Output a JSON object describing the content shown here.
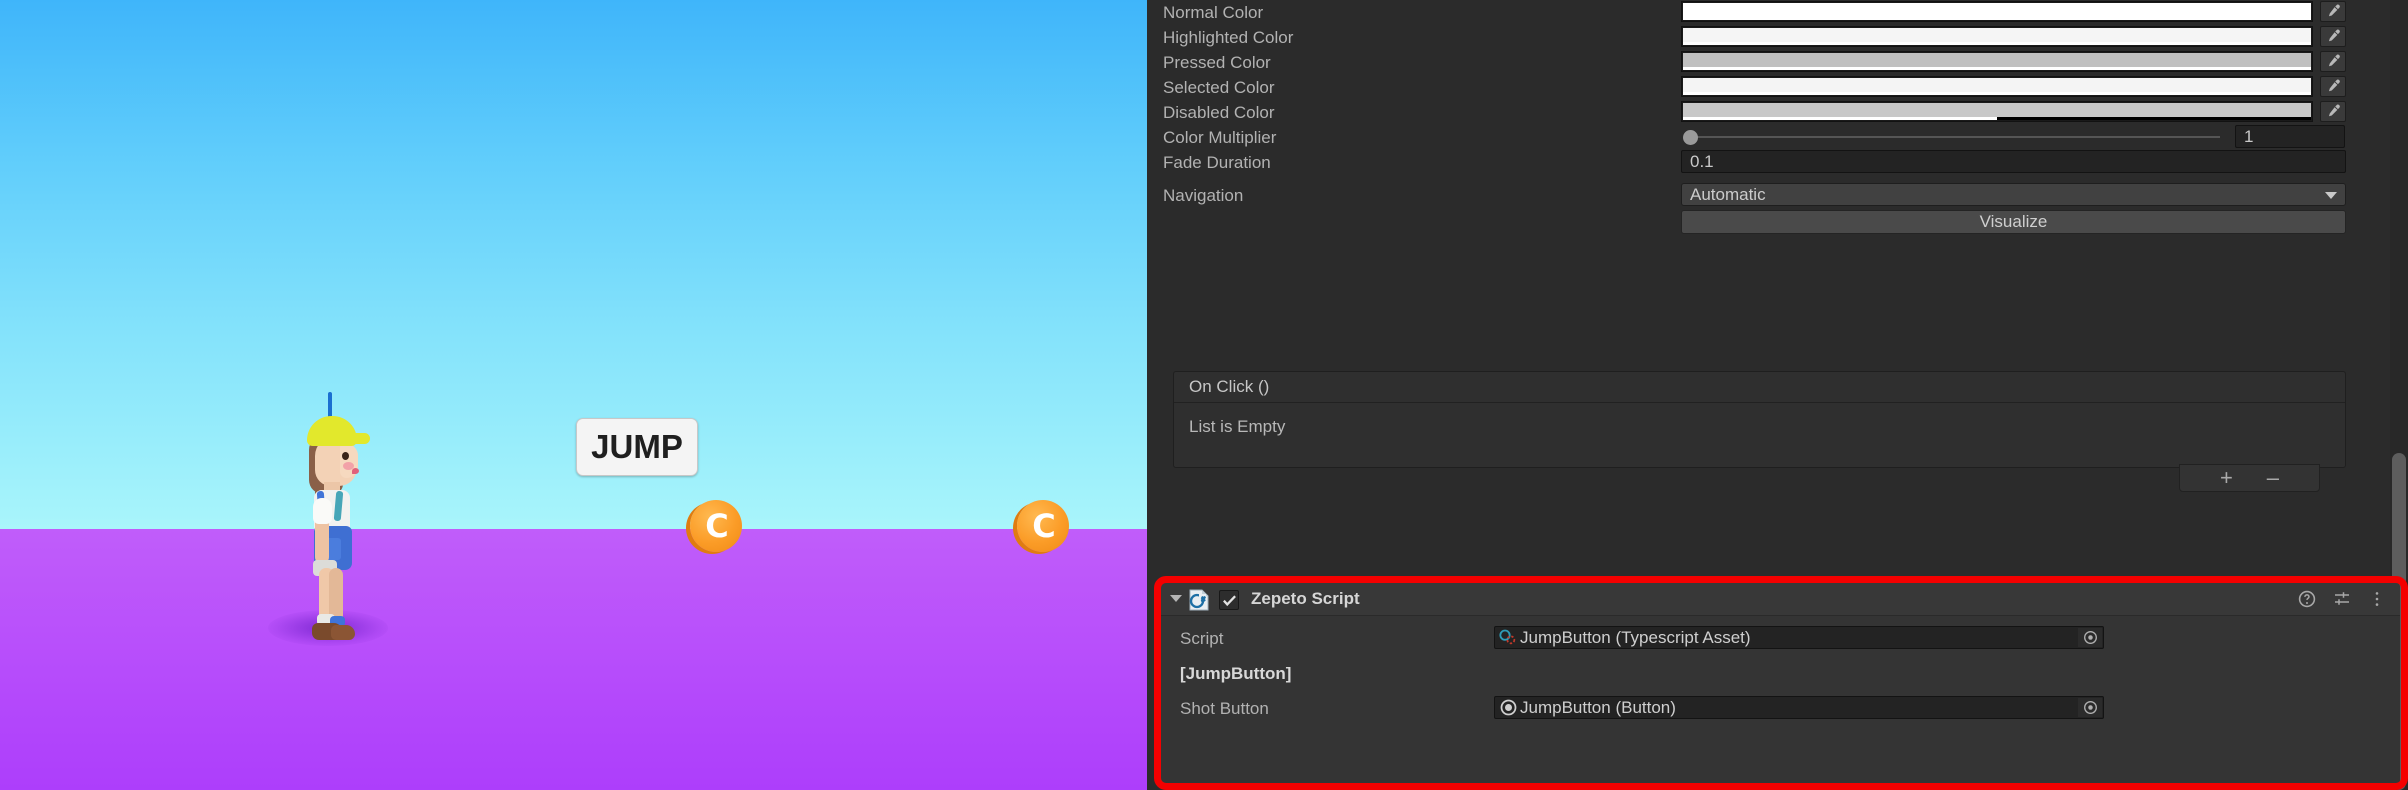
{
  "game_view": {
    "jump_button_label": "JUMP",
    "coin_label": "C",
    "sky_color_top": "#3fb5fa",
    "sky_color_bottom": "#aaf6fb",
    "ground_color": "#b84ffb",
    "coin_color": "#fb9c27"
  },
  "inspector": {
    "transition_rows": [
      {
        "label": "Normal Color",
        "swatch": "#ffffff",
        "alpha": 1.0
      },
      {
        "label": "Highlighted Color",
        "swatch": "#f5f5f5",
        "alpha": 1.0
      },
      {
        "label": "Pressed Color",
        "swatch": "#c0c0c0",
        "alpha": 1.0
      },
      {
        "label": "Selected Color",
        "swatch": "#f4f4f4",
        "alpha": 1.0
      },
      {
        "label": "Disabled Color",
        "swatch": "#c8c8c8",
        "alpha": 0.5
      }
    ],
    "color_multiplier": {
      "label": "Color Multiplier",
      "value": "1"
    },
    "fade_duration": {
      "label": "Fade Duration",
      "value": "0.1"
    },
    "navigation": {
      "label": "Navigation",
      "value": "Automatic"
    },
    "visualize_button": "Visualize",
    "on_click": {
      "header": "On Click ()",
      "empty_text": "List is Empty",
      "add_label": "+",
      "remove_label": "–"
    },
    "zepeto_script": {
      "title": "Zepeto Script",
      "enabled": true,
      "script_icon": "csharp-script-icon",
      "help_icon": "help-icon",
      "preset_icon": "preset-icon",
      "menu_icon": "more-menu-icon",
      "rows": [
        {
          "label": "Script",
          "value": "JumpButton (Typescript Asset)",
          "icon": "typescript-asset-icon"
        },
        {
          "label": "[JumpButton]",
          "value": "",
          "icon": ""
        },
        {
          "label": "Shot Button",
          "value": "JumpButton (Button)",
          "icon": "button-component-icon"
        }
      ],
      "highlight_color": "#f40000"
    }
  }
}
